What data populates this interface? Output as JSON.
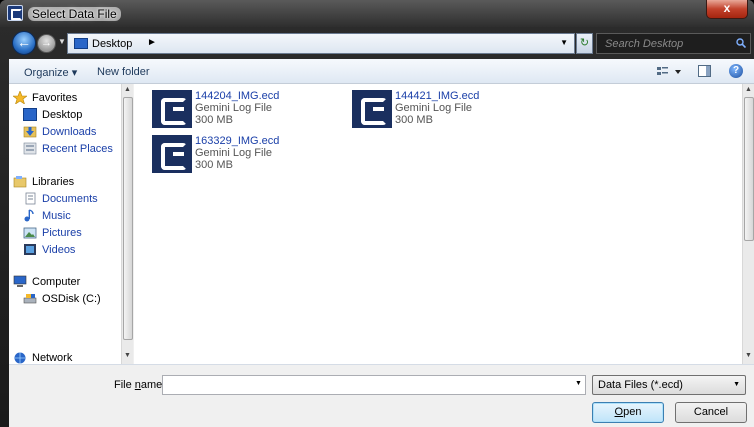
{
  "window": {
    "title": "Select Data File",
    "close_label": "x"
  },
  "address": {
    "current": "Desktop",
    "search_placeholder": "Search Desktop"
  },
  "toolbar": {
    "organize_label": "Organize ▾",
    "new_folder_label": "New folder"
  },
  "nav": {
    "favorites": "Favorites",
    "desktop": "Desktop",
    "downloads": "Downloads",
    "recent": "Recent Places",
    "libraries": "Libraries",
    "documents": "Documents",
    "music": "Music",
    "pictures": "Pictures",
    "videos": "Videos",
    "computer": "Computer",
    "osdisk": "OSDisk (C:)",
    "network": "Network"
  },
  "files": [
    {
      "name": "144204_IMG.ecd",
      "type": "Gemini Log File",
      "size": "300 MB"
    },
    {
      "name": "144421_IMG.ecd",
      "type": "Gemini Log File",
      "size": "300 MB"
    },
    {
      "name": "163329_IMG.ecd",
      "type": "Gemini Log File",
      "size": "300 MB"
    }
  ],
  "bottom": {
    "file_name_label_pre": "File ",
    "file_name_label_ul": "n",
    "file_name_label_post": "ame:",
    "file_name_value": "",
    "filter_value": "Data Files (*.ecd)",
    "open_label_ul": "O",
    "open_label_rest": "pen",
    "cancel_label": "Cancel"
  },
  "colors": {
    "link_blue": "#1a3fa8",
    "file_icon_bg": "#1a2f5f"
  }
}
